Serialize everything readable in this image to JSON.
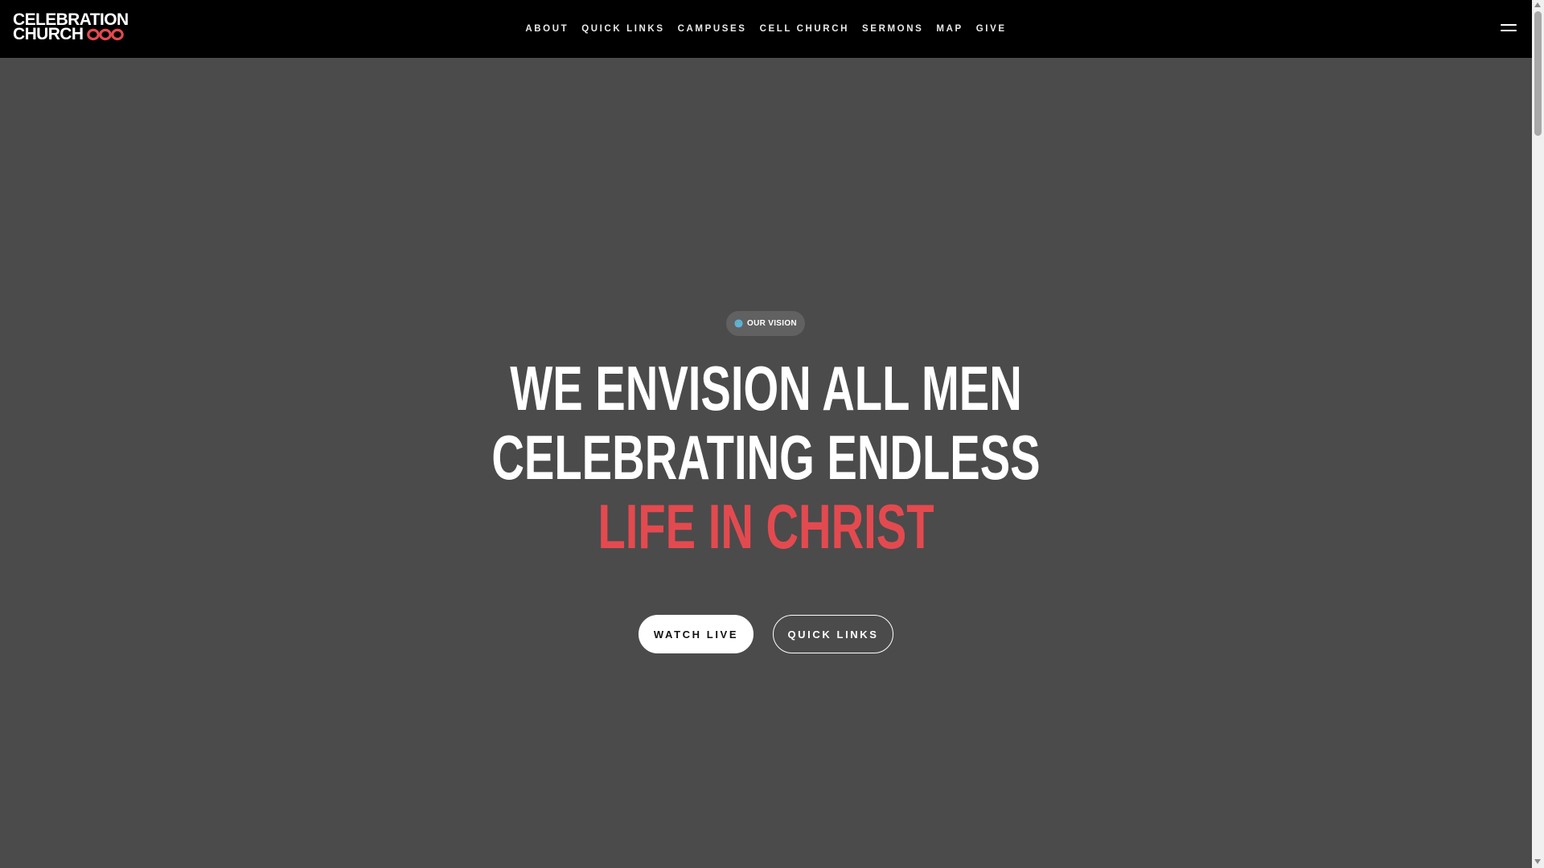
{
  "header": {
    "logo": {
      "line1": "CELEBRATION",
      "line2": "CHURCH",
      "mark_icon": "infinity-logo-icon",
      "mark_color": "#e34a4f"
    },
    "nav": [
      {
        "label": "ABOUT"
      },
      {
        "label": "QUICK LINKS"
      },
      {
        "label": "CAMPUSES"
      },
      {
        "label": "CELL CHURCH"
      },
      {
        "label": "SERMONS"
      },
      {
        "label": "MAP"
      },
      {
        "label": "GIVE"
      }
    ],
    "menu_icon": "hamburger-menu-icon"
  },
  "hero": {
    "badge": {
      "icon": "globe-icon",
      "label": "OUR VISION"
    },
    "headline": {
      "line1": "WE ENVISION ALL MEN",
      "line2": "CELEBRATING ENDLESS",
      "line3": "LIFE IN CHRIST"
    },
    "buttons": {
      "watch_live": "WATCH LIVE",
      "quick_links": "QUICK LINKS"
    }
  },
  "colors": {
    "accent": "#e34a4f",
    "nav_background": "#000000",
    "hero_background": "#4b4b4b"
  }
}
